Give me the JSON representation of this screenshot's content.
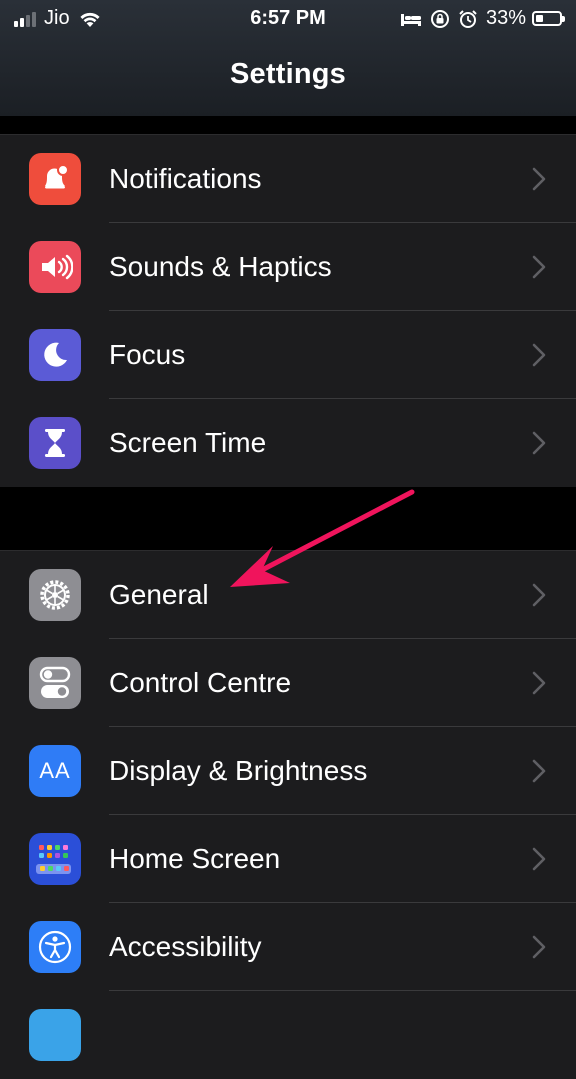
{
  "status_bar": {
    "carrier": "Jio",
    "time": "6:57 PM",
    "battery_percent": "33%",
    "icons": [
      "signal-icon",
      "wifi-icon",
      "bed-icon",
      "orientation-lock-icon",
      "alarm-icon",
      "battery-icon"
    ]
  },
  "header": {
    "title": "Settings"
  },
  "group1": {
    "items": [
      {
        "label": "Notifications",
        "icon": "notifications-icon",
        "color": "#ef4d3c"
      },
      {
        "label": "Sounds & Haptics",
        "icon": "speaker-icon",
        "color": "#eb4a5a"
      },
      {
        "label": "Focus",
        "icon": "moon-icon",
        "color": "#5b5bd6"
      },
      {
        "label": "Screen Time",
        "icon": "hourglass-icon",
        "color": "#5b4fc9"
      }
    ]
  },
  "group2": {
    "items": [
      {
        "label": "General",
        "icon": "gear-icon",
        "color": "#8e8e93"
      },
      {
        "label": "Control Centre",
        "icon": "toggles-icon",
        "color": "#8e8e93"
      },
      {
        "label": "Display & Brightness",
        "icon": "text-size-icon",
        "color": "#2f7cf6",
        "glyph": "AA"
      },
      {
        "label": "Home Screen",
        "icon": "app-grid-icon",
        "color": "#2b4fd8"
      },
      {
        "label": "Accessibility",
        "icon": "accessibility-icon",
        "color": "#2d7ef7"
      }
    ]
  },
  "annotation": {
    "arrow_color": "#f0145c",
    "points_to": "General"
  }
}
